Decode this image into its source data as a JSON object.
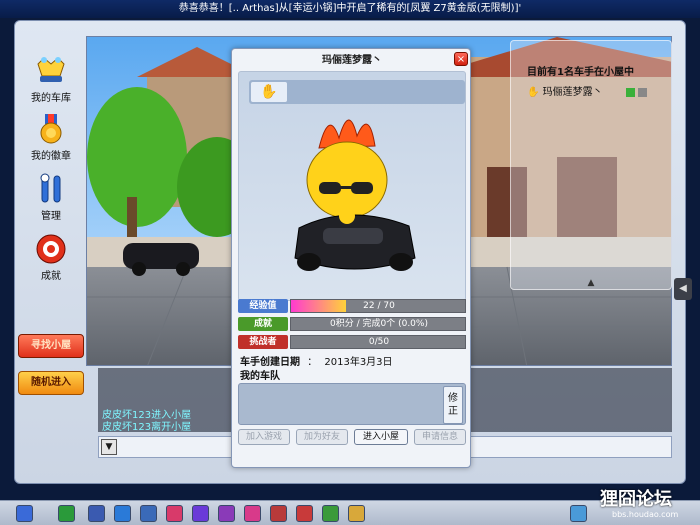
{
  "marquee": {
    "text": "恭喜恭喜！[.. Arthas]从[幸运小锅]中开启了稀有的[凤翼 Z7黄金版(无限制)]'"
  },
  "sidebar": {
    "items": [
      {
        "label": "我的车库",
        "icon": "garage-crown-icon"
      },
      {
        "label": "我的徽章",
        "icon": "medal-icon"
      },
      {
        "label": "管理",
        "icon": "tools-icon"
      },
      {
        "label": "成就",
        "icon": "achievement-icon"
      }
    ],
    "find_room": "寻找小屋",
    "random_enter": "随机进入"
  },
  "room_panel": {
    "count_text": "目前有1名车手在小屋中",
    "player_name": "玛俪莲梦露丶"
  },
  "chat": {
    "lines": [
      "皮皮坏123进入小屋",
      "皮皮坏123离开小屋"
    ],
    "dropdown_symbol": "▼"
  },
  "dialog": {
    "title": "玛俪莲梦露丶",
    "close_symbol": "×",
    "stats": [
      {
        "label": "经验值",
        "value_text": "22 / 70",
        "fraction": 0.314,
        "color": "#4a7ad0"
      },
      {
        "label": "成就",
        "value_text": "0积分 / 完成0个  (0.0%)",
        "fraction": 0,
        "color": "#4a9a2a"
      },
      {
        "label": "挑战者",
        "value_text": "0/50",
        "fraction": 0,
        "color": "#c0302a"
      }
    ],
    "created_label": "车手创建日期",
    "created_sep": "：",
    "created_value": "2013年3月3日",
    "team_label": "我的车队",
    "team_sep": "：",
    "edit_label": "修\n正",
    "buttons": [
      "加入游戏",
      "加为好友",
      "进入小屋",
      "申请信息"
    ]
  },
  "watermark": {
    "title": "狸囧论坛",
    "sub": "bbs.houdao.com"
  }
}
